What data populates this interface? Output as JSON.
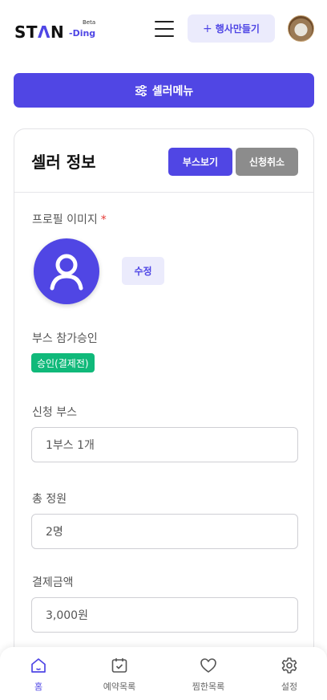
{
  "header": {
    "logo_main_pre": "ST",
    "logo_main_accent": "Λ",
    "logo_main_post": "N",
    "logo_sub": "-Ding",
    "logo_beta": "Beta",
    "make_event_label": "행사만들기",
    "make_event_icon": "plus-icon"
  },
  "seller_menu": {
    "label": "셀러메뉴",
    "icon": "sliders-icon"
  },
  "card": {
    "title": "셀러 정보",
    "booth_view_label": "부스보기",
    "cancel_label": "신청취소",
    "profile_label": "프로필 이미지",
    "required_mark": "*",
    "edit_label": "수정",
    "approval_label": "부스 참가승인",
    "approval_status": "승인(결제전)",
    "booth_label": "신청 부스",
    "booth_value": "1부스 1개",
    "headcount_label": "총 정원",
    "headcount_value": "2명",
    "payment_label": "결제금액",
    "payment_value": "3,000원"
  },
  "colors": {
    "accent": "#5046e4",
    "accent_light": "#ebebfc",
    "success": "#10b97a",
    "muted_button": "#8c8c8c"
  },
  "bottom_nav": {
    "items": [
      {
        "label": "홈",
        "icon": "home-icon",
        "active": true
      },
      {
        "label": "예약목록",
        "icon": "calendar-check-icon",
        "active": false
      },
      {
        "label": "찜한목록",
        "icon": "heart-icon",
        "active": false
      },
      {
        "label": "설정",
        "icon": "gear-icon",
        "active": false
      }
    ]
  }
}
